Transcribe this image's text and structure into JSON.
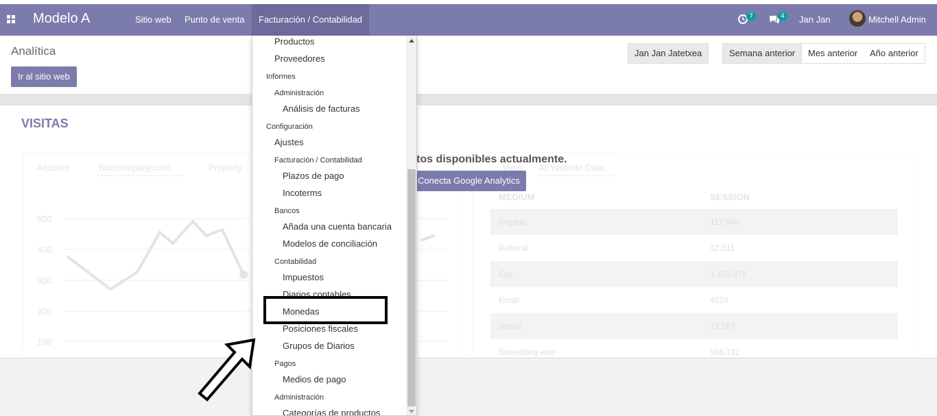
{
  "topbar": {
    "brand": "Modelo A",
    "nav": [
      "Sitio web",
      "Punto de venta",
      "Facturación / Contabilidad"
    ],
    "activity_count": "7",
    "messages_count": "4",
    "company": "Jan Jan",
    "user": "Mitchell Admin",
    "bar_color": "#7c7bad"
  },
  "control_panel": {
    "breadcrumb": "Analítica",
    "goto_website": "Ir al sitio web",
    "website_selector": "Jan Jan Jatetxea",
    "periods": [
      "Semana anterior",
      "Mes anterior",
      "Año anterior"
    ],
    "selected_period": "Semana anterior"
  },
  "main": {
    "section_title": "VISITAS",
    "no_data_message": "tos disponibles actualmente.",
    "connect_button": "Conecta Google Analytics",
    "faded_left": {
      "account_label": "Account",
      "account_value": "Yourcompany.com",
      "property_label": "Property",
      "y_ticks": [
        "500",
        "400",
        "300",
        "200",
        "100"
      ]
    },
    "faded_right": {
      "view_label": "View",
      "view_value": "All Website Data",
      "headers": [
        "MEDIUM",
        "SESSION"
      ],
      "rows": [
        [
          "Organic",
          "117.546"
        ],
        [
          "Referral",
          "32.011"
        ],
        [
          "Cpc",
          "1.435.676"
        ],
        [
          "Email",
          "4223"
        ],
        [
          "Social",
          "13.567"
        ],
        [
          "Something else",
          "566.732"
        ]
      ]
    }
  },
  "dropdown": {
    "entries": [
      {
        "kind": "item",
        "level": 1,
        "label": "Productos"
      },
      {
        "kind": "item",
        "level": 1,
        "label": "Proveedores"
      },
      {
        "kind": "header",
        "level": 0,
        "label": "Informes"
      },
      {
        "kind": "header",
        "level": 1,
        "label": "Administración"
      },
      {
        "kind": "item",
        "level": 2,
        "label": "Análisis de facturas"
      },
      {
        "kind": "header",
        "level": 0,
        "label": "Configuración"
      },
      {
        "kind": "item",
        "level": 1,
        "label": "Ajustes"
      },
      {
        "kind": "header",
        "level": 1,
        "label": "Facturación / Contabilidad"
      },
      {
        "kind": "item",
        "level": 2,
        "label": "Plazos de pago"
      },
      {
        "kind": "item",
        "level": 2,
        "label": "Incoterms"
      },
      {
        "kind": "header",
        "level": 1,
        "label": "Bancos"
      },
      {
        "kind": "item",
        "level": 2,
        "label": "Añada una cuenta bancaria"
      },
      {
        "kind": "item",
        "level": 2,
        "label": "Modelos de conciliación"
      },
      {
        "kind": "header",
        "level": 1,
        "label": "Contabilidad"
      },
      {
        "kind": "item",
        "level": 2,
        "label": "Impuestos"
      },
      {
        "kind": "item",
        "level": 2,
        "label": "Diarios contables"
      },
      {
        "kind": "item",
        "level": 2,
        "label": "Monedas"
      },
      {
        "kind": "item",
        "level": 2,
        "label": "Posiciones fiscales"
      },
      {
        "kind": "item",
        "level": 2,
        "label": "Grupos de Diarios"
      },
      {
        "kind": "header",
        "level": 1,
        "label": "Pagos"
      },
      {
        "kind": "item",
        "level": 2,
        "label": "Medios de pago"
      },
      {
        "kind": "header",
        "level": 1,
        "label": "Administración"
      },
      {
        "kind": "item",
        "level": 2,
        "label": "Categorías de productos"
      }
    ],
    "highlighted": "Monedas"
  }
}
